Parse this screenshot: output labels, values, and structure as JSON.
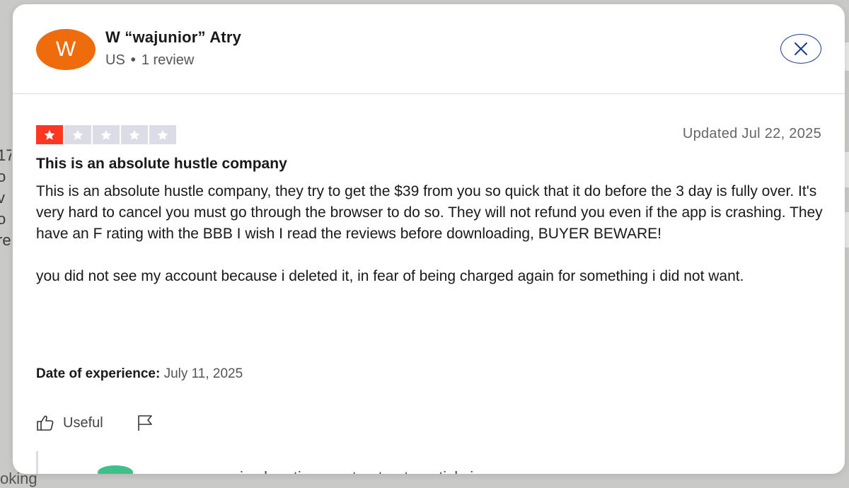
{
  "background": {
    "left_fragments": [
      "17",
      "o",
      "v",
      "o",
      "re"
    ],
    "bottom_fragment": "oking",
    "reply_fragment": "expensive longtime contract automaticly is"
  },
  "review": {
    "author": {
      "initial": "W",
      "name": "W “wajunior” Atry",
      "country": "US",
      "separator": "•",
      "review_count": "1 review",
      "avatar_color": "#ef6c0c"
    },
    "rating": 1,
    "rating_max": 5,
    "star_color": "#ff3722",
    "star_empty_color": "#dcdce6",
    "updated": "Updated Jul 22, 2025",
    "title": "This is an absolute hustle company",
    "paragraphs": [
      "This is an absolute hustle company, they try to get the $39 from you so quick that it do before the 3 day is fully over. It's very hard to cancel you must go through the browser to do so. They will not refund you even if the app is crashing. They have an F rating with the BBB I wish I read the reviews before downloading, BUYER BEWARE!",
      "you did not see my account because i deleted it, in fear of being charged again for something i did not want."
    ],
    "experience_label": "Date of experience:",
    "experience_date": "July 11, 2025",
    "useful_label": "Useful"
  },
  "icons": {
    "close": "close-icon",
    "star": "star-icon",
    "thumbs_up": "thumbs-up-icon",
    "flag": "flag-icon"
  }
}
